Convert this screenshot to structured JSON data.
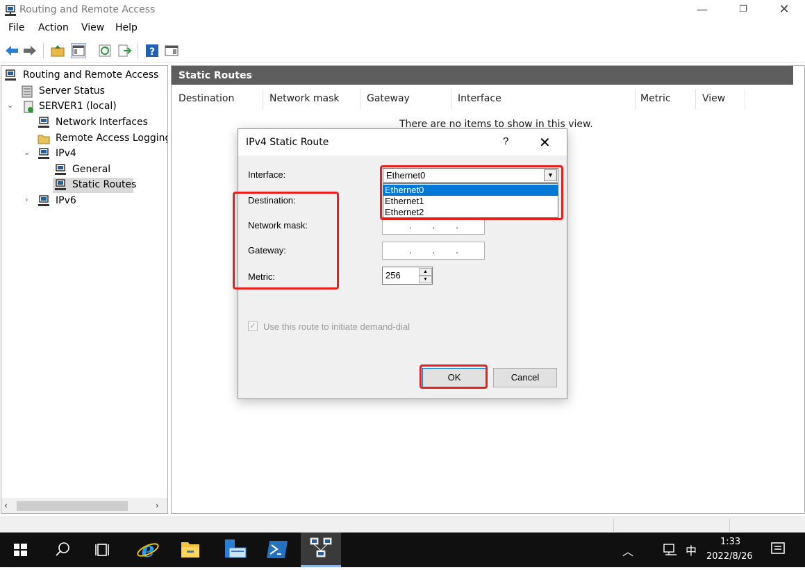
{
  "window": {
    "title": "Routing and Remote Access",
    "icon": "server-network-icon",
    "controls": {
      "minimize": "—",
      "maximize": "❐",
      "close": "✕"
    }
  },
  "menu": [
    "File",
    "Action",
    "View",
    "Help"
  ],
  "toolbar": {
    "icons": [
      "back-arrow-icon",
      "forward-arrow-icon",
      "up-folder-icon",
      "show-hide-tree-icon",
      "refresh-icon",
      "export-list-icon",
      "help-icon",
      "properties-icon"
    ]
  },
  "tree": {
    "items": [
      {
        "label": "Routing and Remote Access",
        "icon": "server-network-icon",
        "level": 0
      },
      {
        "label": "Server Status",
        "icon": "server-status-icon",
        "level": 1
      },
      {
        "label": "SERVER1 (local)",
        "icon": "server-icon",
        "level": 1,
        "expander": "⌄"
      },
      {
        "label": "Network Interfaces",
        "icon": "network-icon",
        "level": 2
      },
      {
        "label": "Remote Access Logging &",
        "icon": "folder-icon",
        "level": 2
      },
      {
        "label": "IPv4",
        "icon": "network-icon",
        "level": 2,
        "expander": "⌄"
      },
      {
        "label": "General",
        "icon": "network-icon",
        "level": 3
      },
      {
        "label": "Static Routes",
        "icon": "network-icon",
        "level": 3,
        "selected": true
      },
      {
        "label": "IPv6",
        "icon": "network-icon",
        "level": 2,
        "expander": "›"
      }
    ],
    "scroll_left": "‹",
    "scroll_right": "›"
  },
  "pane": {
    "header": "Static Routes",
    "columns": [
      "Destination",
      "Network mask",
      "Gateway",
      "Interface",
      "Metric",
      "View"
    ],
    "empty_message": "There are no items to show in this view."
  },
  "dialog": {
    "title": "IPv4 Static Route",
    "help": "?",
    "close": "✕",
    "labels": {
      "interface": "Interface:",
      "destination": "Destination:",
      "network_mask": "Network mask:",
      "gateway": "Gateway:",
      "metric": "Metric:"
    },
    "interface_value": "Ethernet0",
    "interface_options": [
      "Ethernet0",
      "Ethernet1",
      "Ethernet2"
    ],
    "ip_dots": "...",
    "metric_value": "256",
    "spin_up": "▲",
    "spin_down": "▼",
    "demand_dial_label": "Use this route to initiate demand-dial",
    "demand_dial_check": "✓",
    "ok_label": "OK",
    "cancel_label": "Cancel"
  },
  "taskbar": {
    "items": [
      "start-windows-icon",
      "search-icon",
      "task-view-icon",
      "internet-explorer-icon",
      "file-explorer-icon",
      "server-manager-icon",
      "powershell-icon",
      "routing-remote-access-icon"
    ],
    "tray_up": "︿",
    "ime": "中",
    "time": "1:33",
    "date": "2022/8/26"
  },
  "colors": {
    "annotation_red": "#e8201c",
    "selection_blue": "#0078d7",
    "pane_header": "#5e5e5e"
  }
}
